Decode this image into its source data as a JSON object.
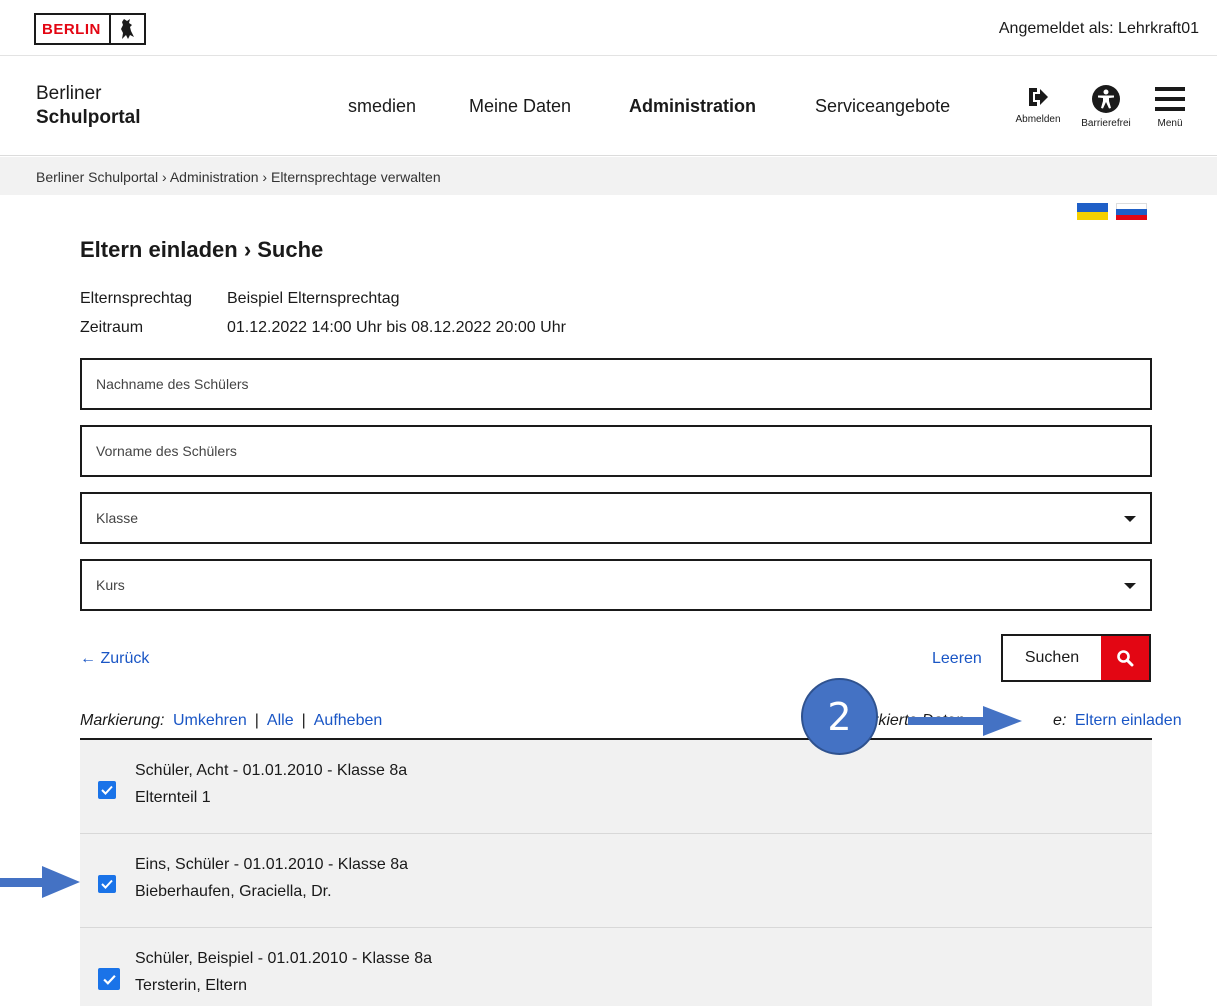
{
  "topbar": {
    "logo_text": "BERLIN",
    "login_status": "Angemeldet als: Lehrkraft01"
  },
  "brand": {
    "line1": "Berliner",
    "line2": "Schulportal"
  },
  "nav": {
    "items": [
      {
        "label": "smedien"
      },
      {
        "label": "Meine Daten"
      },
      {
        "label": "Administration"
      },
      {
        "label": "Serviceangebote"
      }
    ]
  },
  "header_icons": {
    "logout": "Abmelden",
    "accessibility": "Barrierefrei",
    "menu": "Menü"
  },
  "breadcrumb": "Berliner Schulportal › Administration › Elternsprechtage verwalten",
  "page_title": "Eltern einladen › Suche",
  "meta": {
    "sprechtag_key": "Elternsprechtag",
    "sprechtag_value": "Beispiel Elternsprechtag",
    "zeitraum_key": "Zeitraum",
    "zeitraum_value": "01.12.2022 14:00 Uhr bis 08.12.2022 20:00 Uhr"
  },
  "form": {
    "lastname_placeholder": "Nachname des Schülers",
    "firstname_placeholder": "Vorname des Schülers",
    "class_label": "Klasse",
    "course_label": "Kurs"
  },
  "actions": {
    "back": "← Zurück",
    "clear": "Leeren",
    "search": "Suchen"
  },
  "marking": {
    "label": "Markierung:",
    "invert": "Umkehren",
    "sep1": "|",
    "all": "Alle",
    "sep2": "|",
    "clear": "Aufheben"
  },
  "marked_actions": {
    "label": "rkierte Daten ",
    "label_tail": "e:",
    "invite": "Eltern einladen"
  },
  "list": {
    "rows": [
      {
        "line1": "Schüler, Acht - 01.01.2010 - Klasse 8a",
        "line2": "Elternteil 1",
        "checked": true
      },
      {
        "line1": "Eins, Schüler - 01.01.2010 - Klasse 8a",
        "line2": "Bieberhaufen, Graciella, Dr.",
        "checked": true
      },
      {
        "line1": "Schüler, Beispiel - 01.01.2010 - Klasse 8a",
        "line2": "Tersterin, Eltern",
        "checked": true
      }
    ]
  },
  "annotation": {
    "step_number": "2"
  },
  "colors": {
    "berlin_red": "#e30613",
    "link_blue": "#1a56c5",
    "checkbox_blue": "#1a73e8",
    "annotation_blue": "#4472c4"
  }
}
